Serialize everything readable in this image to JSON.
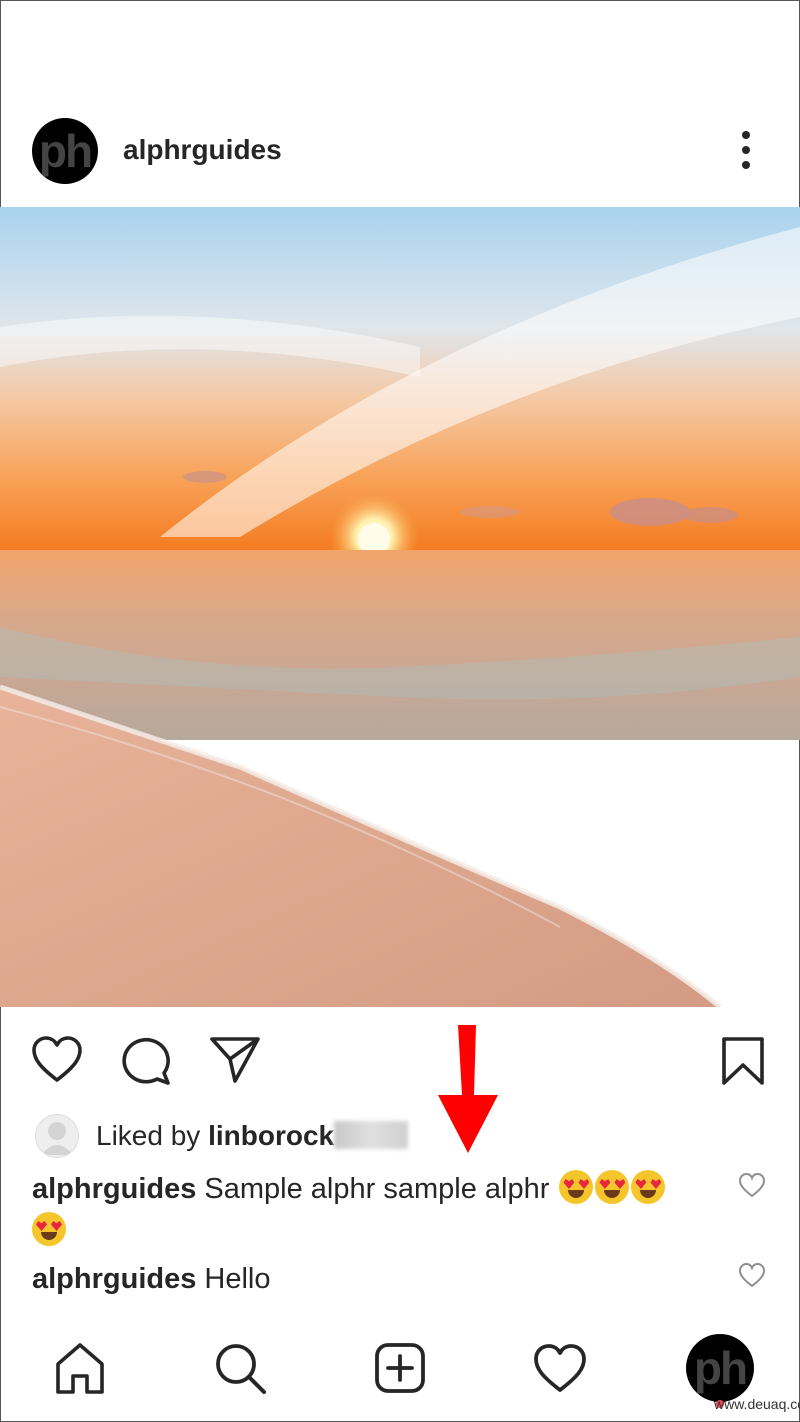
{
  "post": {
    "username": "alphrguides",
    "avatar_text": "ph"
  },
  "photo": {
    "icon": "beach-sunset-photo"
  },
  "likes": {
    "prefix": "Liked by ",
    "user": "linborock"
  },
  "comments": [
    {
      "user": "alphrguides",
      "text": " Sample alphr sample alphr ",
      "emoji_count": 4
    },
    {
      "user": "alphrguides",
      "text": " Hello"
    }
  ],
  "bottom_nav": {
    "items": [
      "home-icon",
      "search-icon",
      "add-post-icon",
      "activity-icon",
      "profile-avatar"
    ]
  },
  "watermark": "www.deuaq.com",
  "colors": {
    "accent_red": "#ff0000",
    "notification": "#ed4956",
    "text": "#262626"
  }
}
